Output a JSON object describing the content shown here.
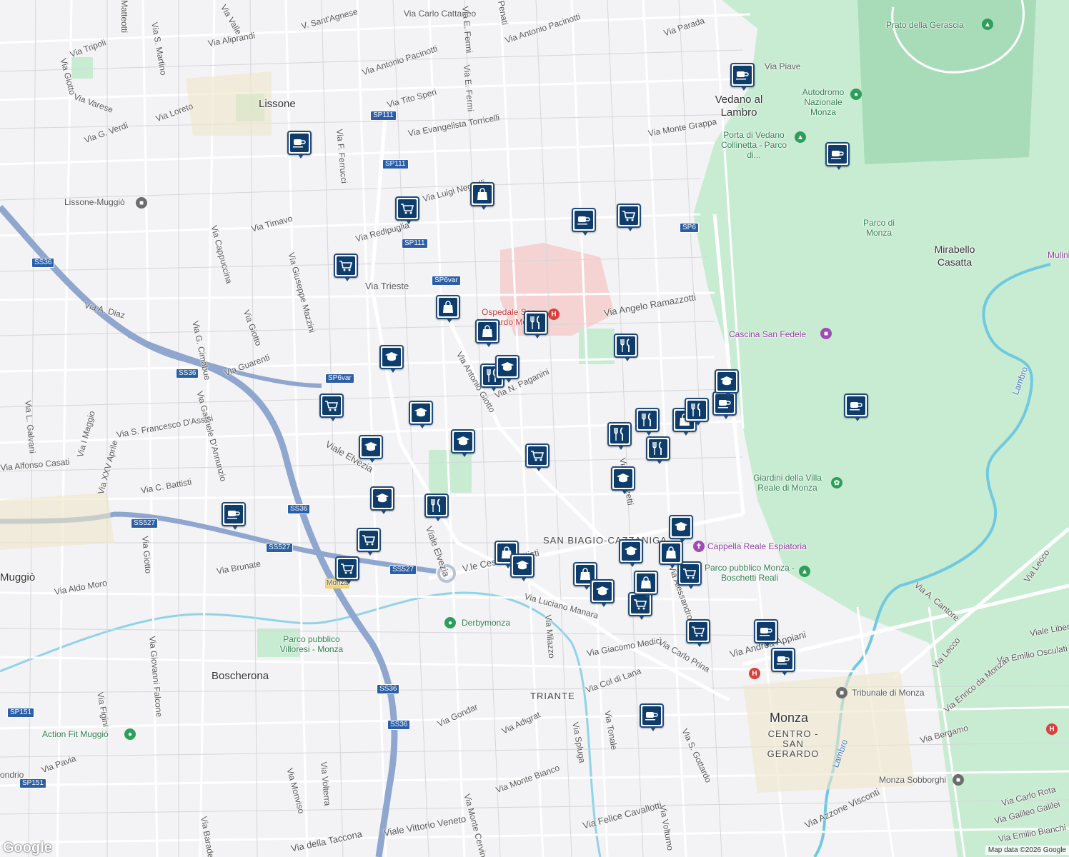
{
  "map": {
    "attribution": "Map data ©2026 Google",
    "logo": "Google",
    "colors": {
      "park": "#c8ecd2",
      "road": "#ffffff",
      "highway": "#8fa6cf",
      "canal": "#8fd3e8",
      "river": "#6fc9e0",
      "poi": "#0f3d6b",
      "hospital_area": "#f5d3d3"
    }
  },
  "places": {
    "lissone": "Lissone",
    "vedano": "Vedano al Lambro",
    "monza": "Monza",
    "centro": "CENTRO - SAN GERARDO",
    "boscherona": "Boscherona",
    "mirabello": "Mirabello Casatta",
    "parco_monza": "Parco di Monza",
    "triante": "TRIANTE",
    "san_biagio": "SAN BIAGIO-CAZZANIGA",
    "muggio": "Muggiò",
    "mulini": "Mulini"
  },
  "landmarks": {
    "prato": "Prato della Gerascia",
    "autodromo": "Autodromo Nazionale Monza",
    "porta_vedano": "Porta di Vedano Collinetta - Parco di...",
    "cascina": "Cascina San Fedele",
    "giardini": "Giardini della Villa Reale di Monza",
    "cappella": "Cappella Reale Espiatoria",
    "boschetti": "Parco pubblico Monza - Boschetti Reali",
    "derbymonza": "Derbymonza",
    "villoresi": "Parco pubblico Villoresi - Monza",
    "actionfit": "Action Fit Muggiò",
    "tribunale": "Tribunale di Monza",
    "ospedale": "Ospedale San Gerardo Monza",
    "lissone_muggio": "Lissone-Muggiò",
    "monza_sobborghi": "Monza Sobborghi",
    "monza_station": "Monza"
  },
  "streets": {
    "carlo_cattaneo": "Via Carlo Cattaneo",
    "matteotti": "Matteotti",
    "s_martino": "Via S. Martino",
    "valle": "Via Valle",
    "sant_agnese": "V. Sant'Agnese",
    "aliprandi": "Via Aliprandi",
    "e_fermi1": "Via E. Fermi",
    "e_fermi2": "Via E. Fermi",
    "penati": "Penati",
    "pacinotti1": "Via Antonio Pacinotti",
    "pacinotti2": "Via Antonio Pacinotti",
    "parada": "Via Parada",
    "tripoli": "Via Tripoli",
    "giotto1": "Via Giotto",
    "varese": "Via Varese",
    "loreto": "Via Loreto",
    "g_verdi": "Via G. Verdi",
    "tito_speri": "Via Tito Speri",
    "torricelli": "Via Evangelista Torricelli",
    "monte_grappa": "Via Monte Grappa",
    "piave": "Via Piave",
    "f_ferrucci": "Via F. Ferrucci",
    "luigi_negrelli": "Via Luigi Negrelli",
    "redipuglia": "Via Redipuglia",
    "timavo": "Via Timavo",
    "cappuccina": "Via Cappuccina",
    "mazzini": "Via Giuseppe Mazzini",
    "trieste": "Via Trieste",
    "a_diaz": "Via A. Diaz",
    "giotto2": "Via Giotto",
    "cimabue": "Via G. Cimabue",
    "guarenti": "Via Guarenti",
    "ramazzotti": "Via Angelo Ramazzotti",
    "antonio_giotto": "Via Antonio Giotto",
    "paganini": "Via N. Paganini",
    "l_galvani": "Via L. Galvani",
    "d_annunzio": "Via Gabriele D'Annunzio",
    "s_francesco": "Via S. Francesco D'Assisi",
    "viale_elvezia1": "Viale Elvezia",
    "viale_elvezia2": "Viale Elvezia",
    "alfonso_casati": "Via Alfonso Casati",
    "i_maggio": "Via I Maggio",
    "xxv_aprile": "Via XXV Aprile",
    "c_battisti": "Via C. Battisti",
    "donizetti": "Via Donizetti",
    "vle_cesare_battisti": "V.le Cesare Battisti",
    "giotto3": "Via Giotto",
    "brunate": "Via Brunate",
    "aldo_moro": "Via Aldo Moro",
    "luciano_manara": "Via Luciano Manara",
    "milazzo": "Via Milazzo",
    "giacomo_medici": "Via Giacomo Medici",
    "carlo_prina": "Via Carlo Prina",
    "andrea_appiani": "Via Andrea Appiani",
    "alessandro_volta": "Via Alessandro Volta",
    "a_cantore": "Via A. Cantore",
    "via_lecco1": "Via Lecco",
    "via_lecco2": "Via Lecco",
    "viale_libertà": "Viale Libertà",
    "emilio_osculati": "Via Emilio Osculati",
    "enrico_da_monza": "Via Enrico da Monza",
    "giovanni_falcone": "Via Giovanni Falcone",
    "figini": "Via Figini",
    "pavia": "Via Pavia",
    "gondar": "Via Gondar",
    "adigrat": "Via Adigrat",
    "col_di_lana": "Via Col di Lana",
    "spluga": "Via Spluga",
    "tonale": "Via Tonale",
    "s_gottardo": "Via S. Gottardo",
    "monviso": "Via Monviso",
    "volterra": "Via Volterra",
    "monte_bianco": "Via Monte Bianco",
    "monte_cervino": "Via Monte Cervino",
    "felice_cavallotti": "Via Felice Cavallotti",
    "volturno": "Via Volturno",
    "della_taccona": "Via della Taccona",
    "vittorio_veneto": "Viale Vittorio Veneto",
    "baradello": "Via Baradello",
    "azzone_visconti": "Via Azzone Visconti",
    "bergamo": "Via Bergamo",
    "carlo_rota": "Via Carlo Rota",
    "galileo_galilei": "Via Galileo Galilei",
    "emilio_bianchi": "Via Emilio Bianchi",
    "lambro1": "Lambro",
    "lambro2": "Lambro",
    "ondrio": "ondrio"
  },
  "shields": [
    "SP111",
    "SP111",
    "SP111",
    "SP6var",
    "SP6var",
    "SS36",
    "SS36",
    "SS36",
    "SS36",
    "SS36",
    "SS527",
    "SS527",
    "SS527",
    "SP6",
    "SP151",
    "SP151"
  ],
  "pois": [
    {
      "type": "cafe-icon"
    },
    {
      "type": "cafe-icon"
    },
    {
      "type": "cafe-icon"
    },
    {
      "type": "cafe-icon"
    },
    {
      "type": "cafe-icon"
    },
    {
      "type": "cafe-icon"
    },
    {
      "type": "cafe-icon"
    },
    {
      "type": "cafe-icon"
    },
    {
      "type": "cafe-icon"
    },
    {
      "type": "cafe-icon"
    },
    {
      "type": "cart-icon"
    },
    {
      "type": "bag-icon"
    },
    {
      "type": "restaurant-icon"
    },
    {
      "type": "school-icon"
    }
  ]
}
